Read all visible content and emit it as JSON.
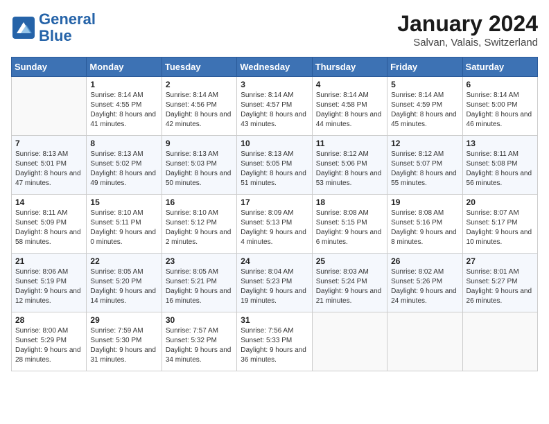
{
  "header": {
    "logo_line1": "General",
    "logo_line2": "Blue",
    "month": "January 2024",
    "location": "Salvan, Valais, Switzerland"
  },
  "weekdays": [
    "Sunday",
    "Monday",
    "Tuesday",
    "Wednesday",
    "Thursday",
    "Friday",
    "Saturday"
  ],
  "weeks": [
    [
      {
        "day": "",
        "sunrise": "",
        "sunset": "",
        "daylight": ""
      },
      {
        "day": "1",
        "sunrise": "8:14 AM",
        "sunset": "4:55 PM",
        "daylight": "8 hours and 41 minutes."
      },
      {
        "day": "2",
        "sunrise": "8:14 AM",
        "sunset": "4:56 PM",
        "daylight": "8 hours and 42 minutes."
      },
      {
        "day": "3",
        "sunrise": "8:14 AM",
        "sunset": "4:57 PM",
        "daylight": "8 hours and 43 minutes."
      },
      {
        "day": "4",
        "sunrise": "8:14 AM",
        "sunset": "4:58 PM",
        "daylight": "8 hours and 44 minutes."
      },
      {
        "day": "5",
        "sunrise": "8:14 AM",
        "sunset": "4:59 PM",
        "daylight": "8 hours and 45 minutes."
      },
      {
        "day": "6",
        "sunrise": "8:14 AM",
        "sunset": "5:00 PM",
        "daylight": "8 hours and 46 minutes."
      }
    ],
    [
      {
        "day": "7",
        "sunrise": "8:13 AM",
        "sunset": "5:01 PM",
        "daylight": "8 hours and 47 minutes."
      },
      {
        "day": "8",
        "sunrise": "8:13 AM",
        "sunset": "5:02 PM",
        "daylight": "8 hours and 49 minutes."
      },
      {
        "day": "9",
        "sunrise": "8:13 AM",
        "sunset": "5:03 PM",
        "daylight": "8 hours and 50 minutes."
      },
      {
        "day": "10",
        "sunrise": "8:13 AM",
        "sunset": "5:05 PM",
        "daylight": "8 hours and 51 minutes."
      },
      {
        "day": "11",
        "sunrise": "8:12 AM",
        "sunset": "5:06 PM",
        "daylight": "8 hours and 53 minutes."
      },
      {
        "day": "12",
        "sunrise": "8:12 AM",
        "sunset": "5:07 PM",
        "daylight": "8 hours and 55 minutes."
      },
      {
        "day": "13",
        "sunrise": "8:11 AM",
        "sunset": "5:08 PM",
        "daylight": "8 hours and 56 minutes."
      }
    ],
    [
      {
        "day": "14",
        "sunrise": "8:11 AM",
        "sunset": "5:09 PM",
        "daylight": "8 hours and 58 minutes."
      },
      {
        "day": "15",
        "sunrise": "8:10 AM",
        "sunset": "5:11 PM",
        "daylight": "9 hours and 0 minutes."
      },
      {
        "day": "16",
        "sunrise": "8:10 AM",
        "sunset": "5:12 PM",
        "daylight": "9 hours and 2 minutes."
      },
      {
        "day": "17",
        "sunrise": "8:09 AM",
        "sunset": "5:13 PM",
        "daylight": "9 hours and 4 minutes."
      },
      {
        "day": "18",
        "sunrise": "8:08 AM",
        "sunset": "5:15 PM",
        "daylight": "9 hours and 6 minutes."
      },
      {
        "day": "19",
        "sunrise": "8:08 AM",
        "sunset": "5:16 PM",
        "daylight": "9 hours and 8 minutes."
      },
      {
        "day": "20",
        "sunrise": "8:07 AM",
        "sunset": "5:17 PM",
        "daylight": "9 hours and 10 minutes."
      }
    ],
    [
      {
        "day": "21",
        "sunrise": "8:06 AM",
        "sunset": "5:19 PM",
        "daylight": "9 hours and 12 minutes."
      },
      {
        "day": "22",
        "sunrise": "8:05 AM",
        "sunset": "5:20 PM",
        "daylight": "9 hours and 14 minutes."
      },
      {
        "day": "23",
        "sunrise": "8:05 AM",
        "sunset": "5:21 PM",
        "daylight": "9 hours and 16 minutes."
      },
      {
        "day": "24",
        "sunrise": "8:04 AM",
        "sunset": "5:23 PM",
        "daylight": "9 hours and 19 minutes."
      },
      {
        "day": "25",
        "sunrise": "8:03 AM",
        "sunset": "5:24 PM",
        "daylight": "9 hours and 21 minutes."
      },
      {
        "day": "26",
        "sunrise": "8:02 AM",
        "sunset": "5:26 PM",
        "daylight": "9 hours and 24 minutes."
      },
      {
        "day": "27",
        "sunrise": "8:01 AM",
        "sunset": "5:27 PM",
        "daylight": "9 hours and 26 minutes."
      }
    ],
    [
      {
        "day": "28",
        "sunrise": "8:00 AM",
        "sunset": "5:29 PM",
        "daylight": "9 hours and 28 minutes."
      },
      {
        "day": "29",
        "sunrise": "7:59 AM",
        "sunset": "5:30 PM",
        "daylight": "9 hours and 31 minutes."
      },
      {
        "day": "30",
        "sunrise": "7:57 AM",
        "sunset": "5:32 PM",
        "daylight": "9 hours and 34 minutes."
      },
      {
        "day": "31",
        "sunrise": "7:56 AM",
        "sunset": "5:33 PM",
        "daylight": "9 hours and 36 minutes."
      },
      {
        "day": "",
        "sunrise": "",
        "sunset": "",
        "daylight": ""
      },
      {
        "day": "",
        "sunrise": "",
        "sunset": "",
        "daylight": ""
      },
      {
        "day": "",
        "sunrise": "",
        "sunset": "",
        "daylight": ""
      }
    ]
  ],
  "labels": {
    "sunrise_prefix": "Sunrise: ",
    "sunset_prefix": "Sunset: ",
    "daylight_prefix": "Daylight: "
  }
}
